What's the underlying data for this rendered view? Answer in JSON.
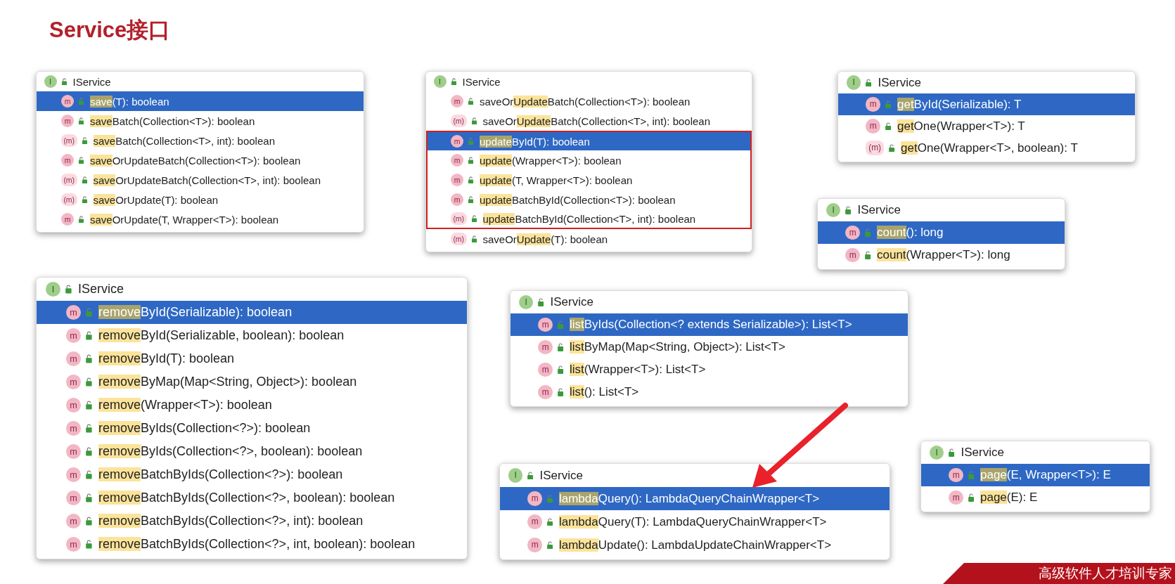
{
  "title": "Service接口",
  "popups": [
    {
      "header": {
        "badge": "I",
        "label": "IService"
      },
      "items": [
        {
          "badge": "m",
          "match": "save",
          "rest": "(T): boolean",
          "selected": true,
          "boxed": false
        },
        {
          "badge": "m",
          "match": "save",
          "rest": "Batch(Collection<T>): boolean",
          "selected": false,
          "boxed": false
        },
        {
          "badge": "(m)",
          "match": "save",
          "rest": "Batch(Collection<T>, int): boolean",
          "selected": false,
          "boxed": false
        },
        {
          "badge": "m",
          "match": "save",
          "rest": "OrUpdateBatch(Collection<T>): boolean",
          "selected": false,
          "boxed": false
        },
        {
          "badge": "(m)",
          "match": "save",
          "rest": "OrUpdateBatch(Collection<T>, int): boolean",
          "selected": false,
          "boxed": false
        },
        {
          "badge": "(m)",
          "match": "save",
          "rest": "OrUpdate(T): boolean",
          "selected": false,
          "boxed": false
        },
        {
          "badge": "m",
          "match": "save",
          "rest": "OrUpdate(T, Wrapper<T>): boolean",
          "selected": false,
          "boxed": false
        }
      ]
    },
    {
      "header": {
        "badge": "I",
        "label": "IService"
      },
      "items": [
        {
          "badge": "m",
          "pre": "saveOr",
          "match": "Update",
          "rest": "Batch(Collection<T>): boolean",
          "selected": false,
          "boxed": false
        },
        {
          "badge": "(m)",
          "pre": "saveOr",
          "match": "Update",
          "rest": "Batch(Collection<T>, int): boolean",
          "selected": false,
          "boxed": false
        },
        {
          "badge": "m",
          "match": "update",
          "rest": "ById(T): boolean",
          "selected": true,
          "boxed": true
        },
        {
          "badge": "m",
          "match": "update",
          "rest": "(Wrapper<T>): boolean",
          "selected": false,
          "boxed": true
        },
        {
          "badge": "m",
          "match": "update",
          "rest": "(T, Wrapper<T>): boolean",
          "selected": false,
          "boxed": true
        },
        {
          "badge": "m",
          "match": "update",
          "rest": "BatchById(Collection<T>): boolean",
          "selected": false,
          "boxed": true
        },
        {
          "badge": "(m)",
          "match": "update",
          "rest": "BatchById(Collection<T>, int): boolean",
          "selected": false,
          "boxed": true
        },
        {
          "badge": "(m)",
          "pre": "saveOr",
          "match": "Update",
          "rest": "(T): boolean",
          "selected": false,
          "boxed": false
        }
      ]
    },
    {
      "header": {
        "badge": "I",
        "label": "IService"
      },
      "items": [
        {
          "badge": "m",
          "match": "get",
          "rest": "ById(Serializable): T",
          "selected": true,
          "boxed": false
        },
        {
          "badge": "m",
          "match": "get",
          "rest": "One(Wrapper<T>): T",
          "selected": false,
          "boxed": false
        },
        {
          "badge": "(m)",
          "match": "get",
          "rest": "One(Wrapper<T>, boolean): T",
          "selected": false,
          "boxed": false
        }
      ]
    },
    {
      "header": {
        "badge": "I",
        "label": "IService"
      },
      "items": [
        {
          "badge": "m",
          "match": "count",
          "rest": "(): long",
          "selected": true,
          "boxed": false
        },
        {
          "badge": "m",
          "match": "count",
          "rest": "(Wrapper<T>): long",
          "selected": false,
          "boxed": false
        }
      ]
    },
    {
      "header": {
        "badge": "I",
        "label": "IService"
      },
      "items": [
        {
          "badge": "m",
          "match": "remove",
          "rest": "ById(Serializable): boolean",
          "selected": true,
          "boxed": false
        },
        {
          "badge": "m",
          "match": "remove",
          "rest": "ById(Serializable, boolean): boolean",
          "selected": false,
          "boxed": false
        },
        {
          "badge": "m",
          "match": "remove",
          "rest": "ById(T): boolean",
          "selected": false,
          "boxed": false
        },
        {
          "badge": "m",
          "match": "remove",
          "rest": "ByMap(Map<String, Object>): boolean",
          "selected": false,
          "boxed": false
        },
        {
          "badge": "m",
          "match": "remove",
          "rest": "(Wrapper<T>): boolean",
          "selected": false,
          "boxed": false
        },
        {
          "badge": "m",
          "match": "remove",
          "rest": "ByIds(Collection<?>): boolean",
          "selected": false,
          "boxed": false
        },
        {
          "badge": "m",
          "match": "remove",
          "rest": "ByIds(Collection<?>, boolean): boolean",
          "selected": false,
          "boxed": false
        },
        {
          "badge": "m",
          "match": "remove",
          "rest": "BatchByIds(Collection<?>): boolean",
          "selected": false,
          "boxed": false
        },
        {
          "badge": "m",
          "match": "remove",
          "rest": "BatchByIds(Collection<?>, boolean): boolean",
          "selected": false,
          "boxed": false
        },
        {
          "badge": "m",
          "match": "remove",
          "rest": "BatchByIds(Collection<?>, int): boolean",
          "selected": false,
          "boxed": false
        },
        {
          "badge": "m",
          "match": "remove",
          "rest": "BatchByIds(Collection<?>, int, boolean): boolean",
          "selected": false,
          "boxed": false
        }
      ]
    },
    {
      "header": {
        "badge": "I",
        "label": "IService"
      },
      "items": [
        {
          "badge": "m",
          "match": "list",
          "rest": "ByIds(Collection<? extends Serializable>): List<T>",
          "selected": true,
          "boxed": false
        },
        {
          "badge": "m",
          "match": "list",
          "rest": "ByMap(Map<String, Object>): List<T>",
          "selected": false,
          "boxed": false
        },
        {
          "badge": "m",
          "match": "list",
          "rest": "(Wrapper<T>): List<T>",
          "selected": false,
          "boxed": false
        },
        {
          "badge": "m",
          "match": "list",
          "rest": "(): List<T>",
          "selected": false,
          "boxed": false
        }
      ]
    },
    {
      "header": {
        "badge": "I",
        "label": "IService"
      },
      "items": [
        {
          "badge": "m",
          "match": "lambda",
          "rest": "Query(): LambdaQueryChainWrapper<T>",
          "selected": true,
          "boxed": false
        },
        {
          "badge": "m",
          "match": "lambda",
          "rest": "Query(T): LambdaQueryChainWrapper<T>",
          "selected": false,
          "boxed": false
        },
        {
          "badge": "m",
          "match": "lambda",
          "rest": "Update(): LambdaUpdateChainWrapper<T>",
          "selected": false,
          "boxed": false
        }
      ]
    },
    {
      "header": {
        "badge": "I",
        "label": "IService"
      },
      "items": [
        {
          "badge": "m",
          "match": "page",
          "rest": "(E, Wrapper<T>): E",
          "selected": true,
          "boxed": false
        },
        {
          "badge": "m",
          "match": "page",
          "rest": "(E): E",
          "selected": false,
          "boxed": false
        }
      ]
    }
  ],
  "banner": {
    "text": "高级软件人才培训专家"
  }
}
